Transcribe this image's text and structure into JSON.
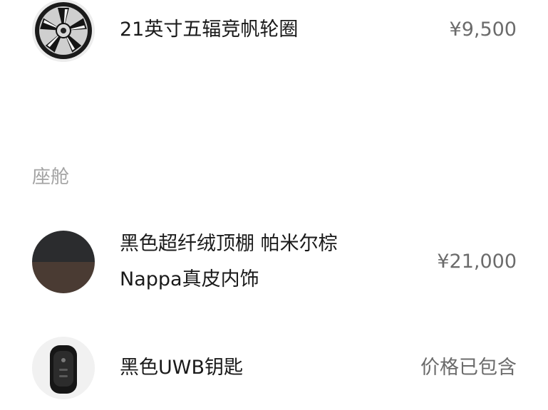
{
  "items": [
    {
      "name": "21英寸五辐竞帆轮圈",
      "price": "¥9,500",
      "icon": "wheel-rim-icon"
    },
    {
      "name_line1": "黑色超纤绒顶棚 帕米尔棕",
      "name_line2": "Nappa真皮内饰",
      "price": "¥21,000",
      "icon": "interior-color-swatch-icon",
      "colors": {
        "top": "#2b2c2e",
        "bottom": "#4a3b33"
      }
    },
    {
      "name": "黑色UWB钥匙",
      "price": "价格已包含",
      "icon": "car-key-icon"
    }
  ],
  "sections": {
    "cabin_title": "座舱"
  }
}
